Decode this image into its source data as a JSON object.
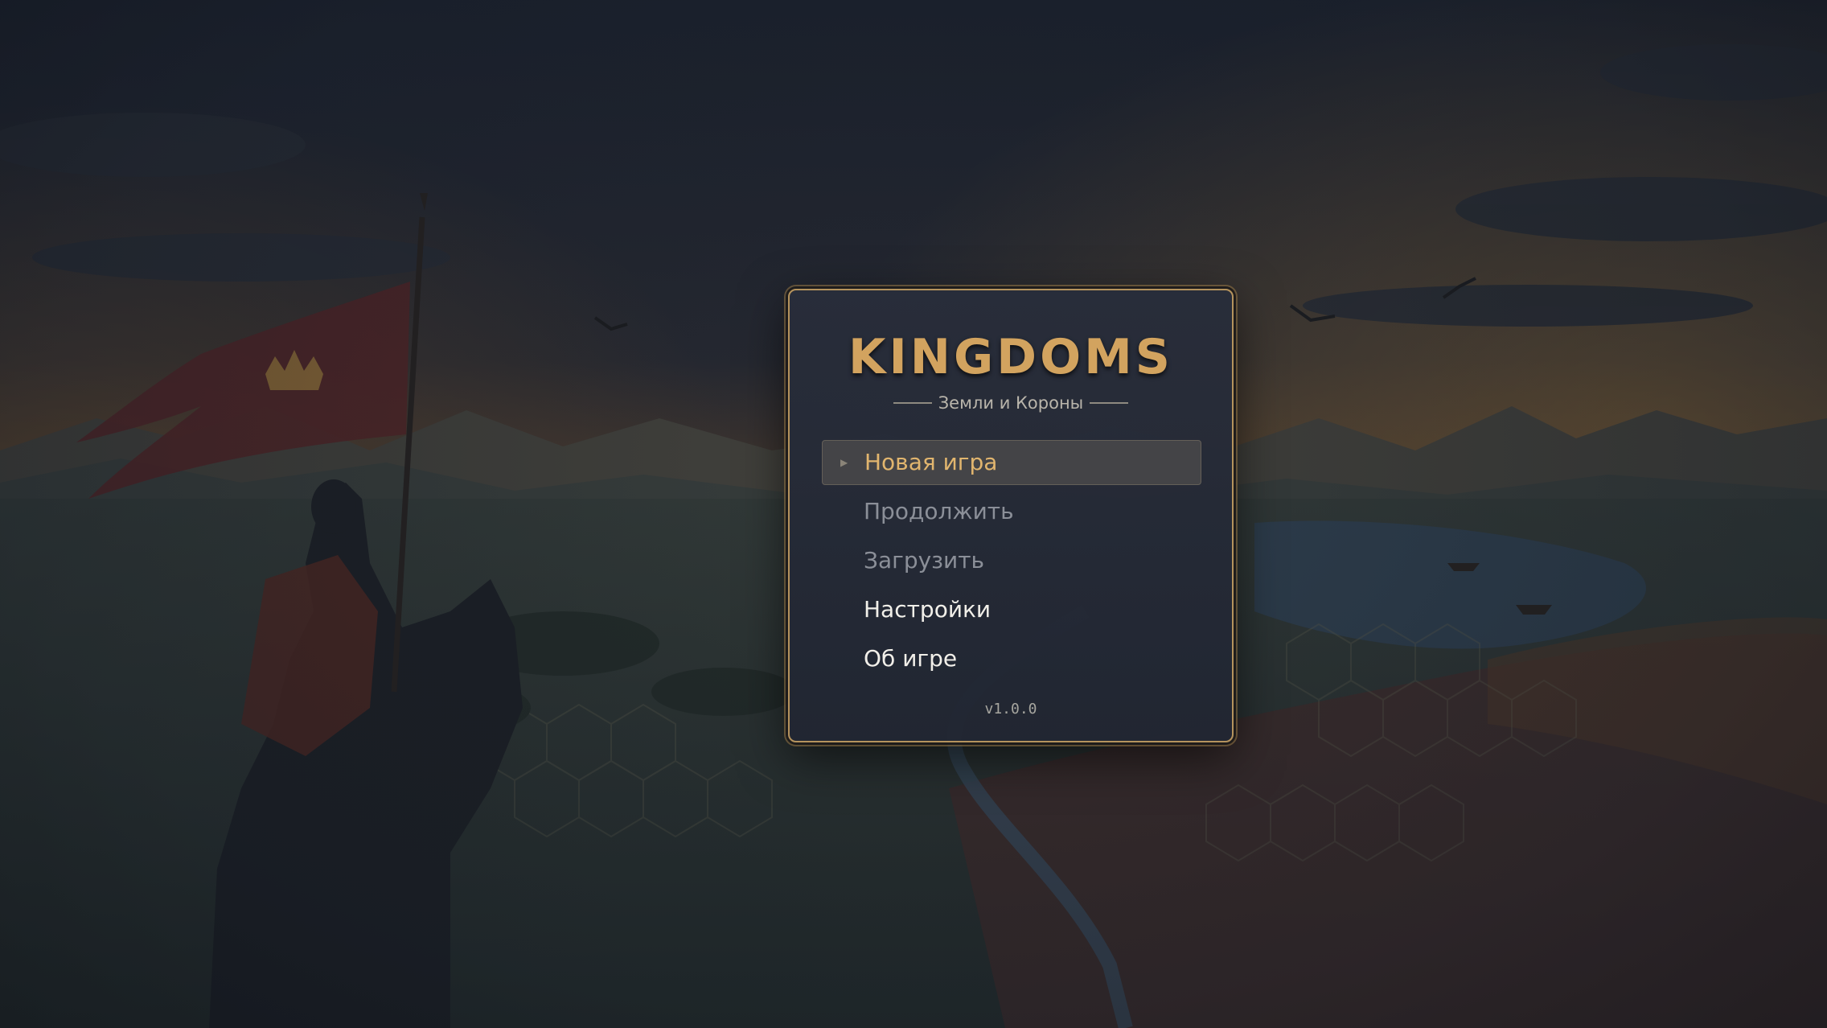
{
  "game": {
    "title": "KINGDOMS",
    "subtitle": "Земли и Короны",
    "version": "v1.0.0"
  },
  "menu": {
    "items": [
      {
        "label": "Новая игра",
        "state": "selected"
      },
      {
        "label": "Продолжить",
        "state": "disabled"
      },
      {
        "label": "Загрузить",
        "state": "disabled"
      },
      {
        "label": "Настройки",
        "state": "enabled"
      },
      {
        "label": "Об игре",
        "state": "enabled"
      }
    ],
    "selector_icon": "triangle-right-icon"
  },
  "colors": {
    "accent_gold": "#d2a35f",
    "selected_text": "#e1b56e",
    "disabled_text": "#8b8f98",
    "enabled_text": "#f1efe9",
    "panel_border": "#b5935d"
  }
}
